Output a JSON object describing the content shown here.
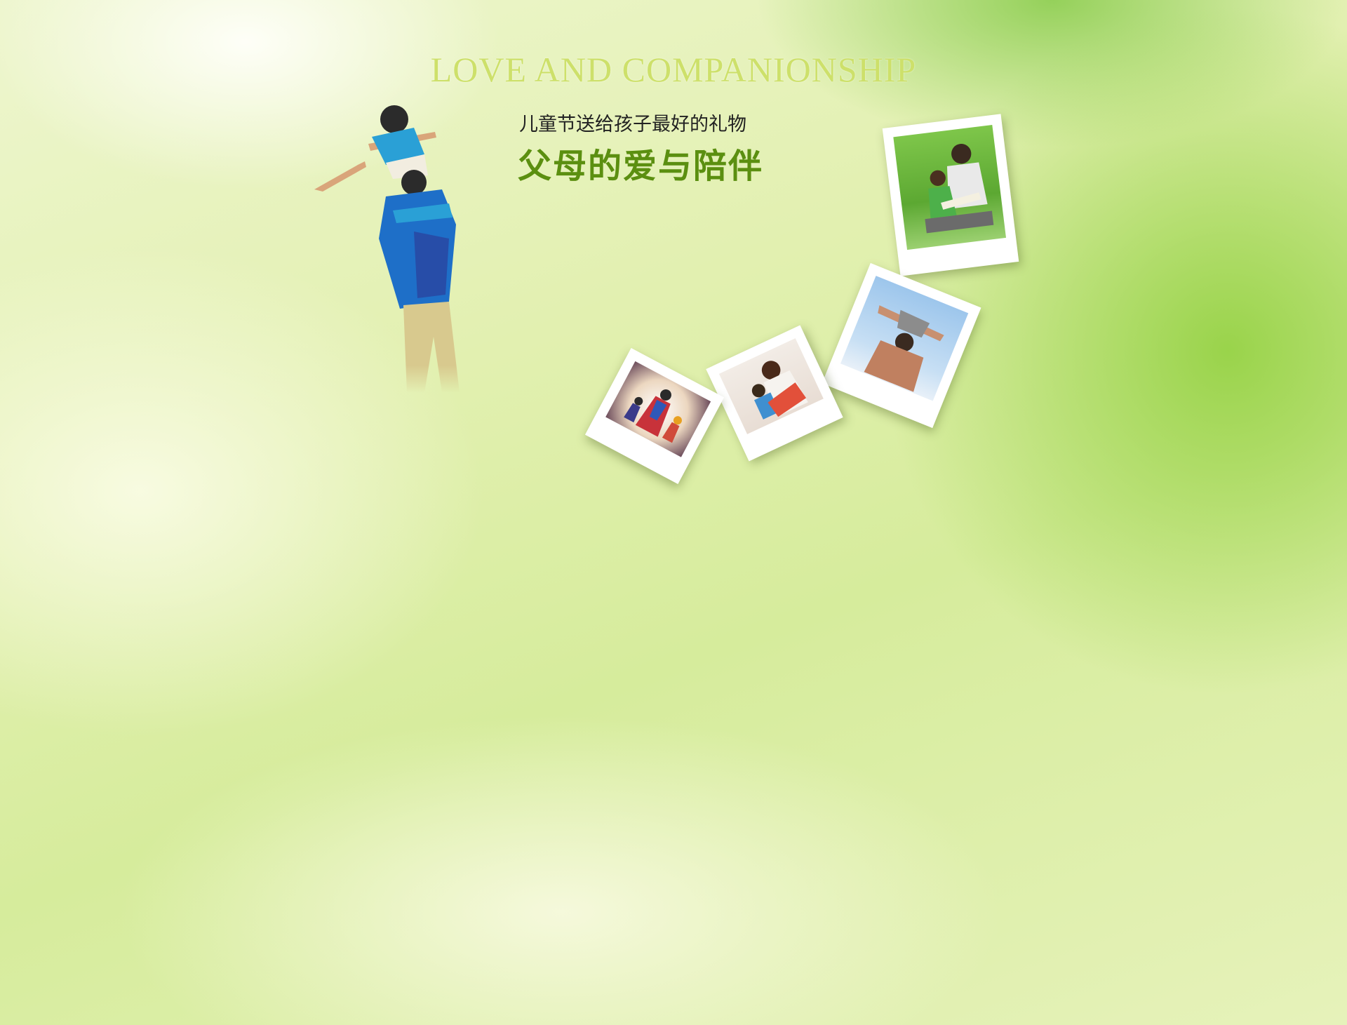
{
  "banner": {
    "headline": "LOVE AND COMPANIONSHIP",
    "subtitle": "儿童节送给孩子最好的礼物",
    "title": "父母的爱与陪伴"
  },
  "colors": {
    "headline": "#cde06a",
    "title": "#5b8f10",
    "subtitle": "#222222",
    "background": "#e2f0b0"
  },
  "photos": [
    {
      "name": "father-reading-with-daughter-photo"
    },
    {
      "name": "father-lifting-child-photo"
    },
    {
      "name": "mother-reading-with-child-photo"
    },
    {
      "name": "superhero-family-walking-photo"
    }
  ]
}
